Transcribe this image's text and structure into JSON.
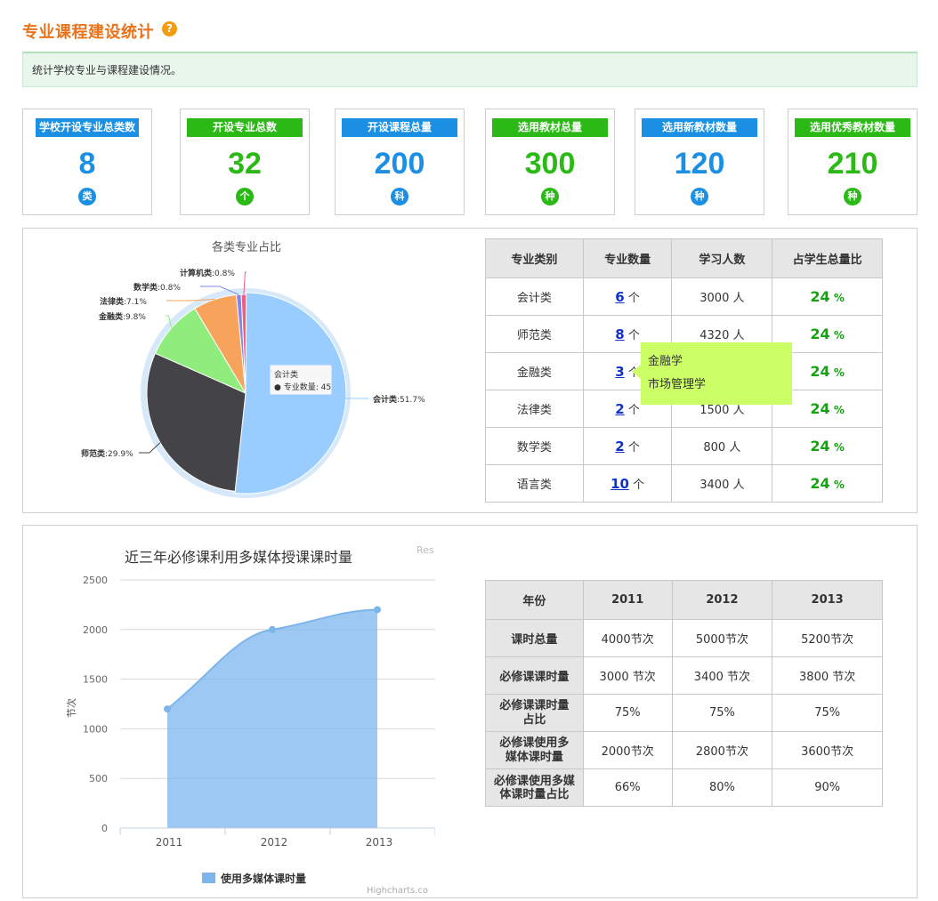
{
  "header": {
    "title": "专业课程建设统计",
    "help_icon": "?"
  },
  "description": "统计学校专业与课程建设情况。",
  "stats": [
    {
      "label": "学校开设专业总类数",
      "value": "8",
      "unit": "类",
      "color": "#1a8fe3"
    },
    {
      "label": "开设专业总数",
      "value": "32",
      "unit": "个",
      "color": "#2ab915"
    },
    {
      "label": "开设课程总量",
      "value": "200",
      "unit": "科",
      "color": "#1a8fe3"
    },
    {
      "label": "选用教材总量",
      "value": "300",
      "unit": "种",
      "color": "#2ab915"
    },
    {
      "label": "选用新教材数量",
      "value": "120",
      "unit": "种",
      "color": "#1a8fe3"
    },
    {
      "label": "选用优秀教材数量",
      "value": "210",
      "unit": "种",
      "color": "#2ab915"
    }
  ],
  "major_table": {
    "headers": [
      "专业类别",
      "专业数量",
      "学习人数",
      "占学生总量比"
    ],
    "rows": [
      {
        "category": "会计类",
        "count": "6",
        "count_unit": "个",
        "students": "3000 人",
        "pct": "24",
        "pct_unit": "%"
      },
      {
        "category": "师范类",
        "count": "8",
        "count_unit": "个",
        "students": "4320 人",
        "pct": "24",
        "pct_unit": "%"
      },
      {
        "category": "金融类",
        "count": "3",
        "count_unit": "个",
        "students": "",
        "pct": "24",
        "pct_unit": "%"
      },
      {
        "category": "法律类",
        "count": "2",
        "count_unit": "个",
        "students": "1500 人",
        "pct": "24",
        "pct_unit": "%"
      },
      {
        "category": "数学类",
        "count": "2",
        "count_unit": "个",
        "students": "800 人",
        "pct": "24",
        "pct_unit": "%"
      },
      {
        "category": "语言类",
        "count": "10",
        "count_unit": "个",
        "students": "3400 人",
        "pct": "24",
        "pct_unit": "%"
      }
    ],
    "popup": {
      "items": [
        "金融学",
        "市场管理学"
      ]
    }
  },
  "hours_table": {
    "headers": [
      "年份",
      "2011",
      "2012",
      "2013"
    ],
    "rows": [
      {
        "label": "课时总量",
        "values": [
          "4000节次",
          "5000节次",
          "5200节次"
        ]
      },
      {
        "label": "必修课课时量",
        "values": [
          "3000 节次",
          "3400 节次",
          "3800 节次"
        ]
      },
      {
        "label": "必修课课时量占比",
        "values": [
          "75%",
          "75%",
          "75%"
        ]
      },
      {
        "label": "必修课使用多媒体课时量",
        "values": [
          "2000节次",
          "2800节次",
          "3600节次"
        ]
      },
      {
        "label": "必修课使用多媒体课时量占比",
        "values": [
          "66%",
          "80%",
          "90%"
        ]
      }
    ]
  },
  "chart_data": [
    {
      "type": "pie",
      "title": "各类专业占比",
      "slices": [
        {
          "name": "会计类",
          "pct": 51.7,
          "color": "#99ccff"
        },
        {
          "name": "师范类",
          "pct": 29.9,
          "color": "#434348"
        },
        {
          "name": "金融类",
          "pct": 9.8,
          "color": "#90ed7d"
        },
        {
          "name": "法律类",
          "pct": 7.1,
          "color": "#f7a35c"
        },
        {
          "name": "数学类",
          "pct": 0.8,
          "color": "#8085e9"
        },
        {
          "name": "计算机类",
          "pct": 0.8,
          "color": "#f15c80"
        }
      ],
      "tooltip": {
        "series_name": "会计类",
        "label": "专业数量",
        "value": "45"
      }
    },
    {
      "type": "area",
      "title": "近三年必修课利用多媒体授课课时量",
      "xlabel": "",
      "ylabel": "节次",
      "categories": [
        "2011",
        "2012",
        "2013"
      ],
      "yticks": [
        "0",
        "500",
        "1000",
        "1500",
        "2000",
        "2500"
      ],
      "ylim": [
        0,
        2500
      ],
      "series": [
        {
          "name": "使用多媒体课时量",
          "values": [
            1200,
            2000,
            2200
          ],
          "color": "#7cb5ec"
        }
      ],
      "corner_text": "Res",
      "credit": "Highcharts.co"
    }
  ]
}
